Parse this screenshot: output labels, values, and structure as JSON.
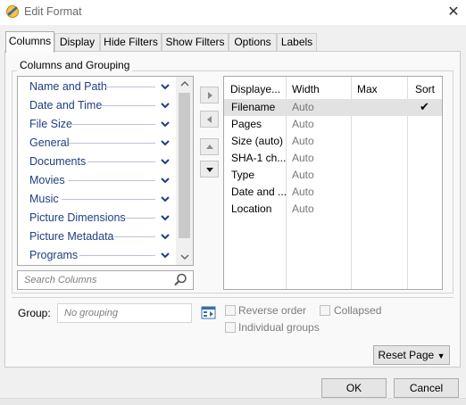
{
  "window": {
    "title": "Edit Format",
    "close_glyph": "✕"
  },
  "tabs": [
    {
      "label": "Columns",
      "active": true
    },
    {
      "label": "Display",
      "active": false
    },
    {
      "label": "Hide Filters",
      "active": false
    },
    {
      "label": "Show Filters",
      "active": false
    },
    {
      "label": "Options",
      "active": false
    },
    {
      "label": "Labels",
      "active": false
    }
  ],
  "group": {
    "title": "Columns and Grouping"
  },
  "column_list": {
    "items": [
      "Name and Path",
      "Date and Time",
      "File Size",
      "General",
      "Documents",
      "Movies",
      "Music",
      "Picture Dimensions",
      "Picture Metadata",
      "Programs"
    ],
    "item_icon": "chevron-down-icon"
  },
  "search": {
    "placeholder": "Search Columns",
    "icon": "search-icon"
  },
  "move_buttons": [
    "move-right-icon",
    "move-left-icon",
    "move-up-icon",
    "move-down-icon"
  ],
  "grid": {
    "headers": [
      "Displaye...",
      "Width",
      "Max",
      "Sort"
    ],
    "rows": [
      {
        "name": "Filename",
        "width": "Auto",
        "max": "",
        "sort": "✔",
        "selected": true
      },
      {
        "name": "Pages",
        "width": "Auto",
        "max": "",
        "sort": ""
      },
      {
        "name": "Size (auto)",
        "width": "Auto",
        "max": "",
        "sort": ""
      },
      {
        "name": "SHA-1 ch...",
        "width": "Auto",
        "max": "",
        "sort": ""
      },
      {
        "name": "Type",
        "width": "Auto",
        "max": "",
        "sort": ""
      },
      {
        "name": "Date and ...",
        "width": "Auto",
        "max": "",
        "sort": ""
      },
      {
        "name": "Location",
        "width": "Auto",
        "max": "",
        "sort": ""
      }
    ]
  },
  "grouping": {
    "label": "Group:",
    "placeholder": "No grouping",
    "reverse_order": "Reverse order",
    "collapsed": "Collapsed",
    "individual_groups": "Individual groups"
  },
  "buttons": {
    "reset": "Reset Page",
    "ok": "OK",
    "cancel": "Cancel"
  },
  "colors": {
    "list_text": "#1e3f80",
    "selected_row": "#e2e2e2",
    "window_bg": "#f0f0f0"
  }
}
